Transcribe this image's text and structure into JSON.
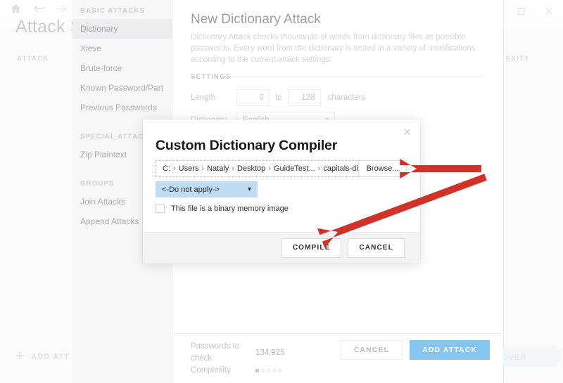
{
  "window": {
    "title": "Attack S",
    "nav": {
      "home_icon": "home-icon",
      "back_icon": "arrow-left-icon",
      "forward_icon": "arrow-right-icon"
    },
    "controls": {
      "minimize": "minimize-icon",
      "maximize": "maximize-icon",
      "close": "close-icon"
    }
  },
  "background": {
    "column_attack": "ATTACK",
    "column_complexity": "COMPLEXITY",
    "add_attack_label": "ADD ATT",
    "add_attack_plus": "+",
    "recover_label": "RECOVER"
  },
  "sidebar": {
    "groups": [
      {
        "label": "BASIC ATTACKS",
        "items": [
          {
            "label": "Dictionary",
            "active": true
          },
          {
            "label": "Xieve",
            "active": false
          },
          {
            "label": "Brute-force",
            "active": false
          },
          {
            "label": "Known Password/Part",
            "active": false
          },
          {
            "label": "Previous Passwords",
            "active": false
          }
        ]
      },
      {
        "label": "SPECIAL ATTACKS",
        "items": [
          {
            "label": "Zip Plaintext",
            "active": false
          }
        ]
      },
      {
        "label": "GROUPS",
        "items": [
          {
            "label": "Join Attacks",
            "active": false
          },
          {
            "label": "Append Attacks",
            "active": false
          }
        ]
      }
    ]
  },
  "panel": {
    "title": "New Dictionary Attack",
    "description": "Dictionary Attack checks thousands of words from dictionary files as possible passwords. Every word from the dictionary is tested in a variety of modifications according to the current attack settings.",
    "settings_label": "SETTINGS",
    "length": {
      "label": "Length",
      "min": "0",
      "to": "to",
      "max": "128",
      "unit": "characters"
    },
    "dictionary": {
      "label": "Dictionary",
      "value": "English",
      "chevron": "chevron-down-icon"
    },
    "footer": {
      "passwords_key": "Passwords to check",
      "passwords_value": "134,925",
      "complexity_key": "Complexity",
      "complexity_filled": 1,
      "complexity_total": 5,
      "cancel_label": "CANCEL",
      "add_attack_label": "ADD ATTACK",
      "primary_color": "#85c5ef"
    }
  },
  "dialog": {
    "title": "Custom Dictionary Compiler",
    "close_icon": "close-icon",
    "path": {
      "segments": [
        "C:",
        "Users",
        "Nataly",
        "Desktop",
        "GuideTest...",
        "capitals-dictionary.txt"
      ],
      "separator": "›",
      "full_text": "C: › Users › Nataly › Desktop › GuideTest... › capitals-dictionary.txt"
    },
    "browse_label": "Browse...",
    "apply_select": {
      "value": "<-Do not apply->",
      "chevron": "chevron-down-icon",
      "background": "#bfdcf3"
    },
    "checkbox": {
      "label": "This file is a binary memory image",
      "checked": false
    },
    "compile_label": "COMPILE",
    "cancel_label": "CANCEL"
  },
  "annotations": {
    "color": "#d03228",
    "arrows": [
      {
        "name": "arrow-to-browse-button"
      },
      {
        "name": "arrow-to-compile-button"
      }
    ]
  }
}
